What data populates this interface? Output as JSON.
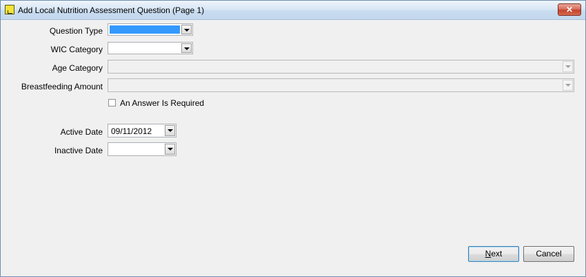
{
  "window": {
    "title": "Add Local Nutrition Assessment Question (Page 1)",
    "close_label": "✕"
  },
  "form": {
    "question_type": {
      "label": "Question Type",
      "value": ""
    },
    "wic_category": {
      "label": "WIC Category",
      "value": ""
    },
    "age_category": {
      "label": "Age Category",
      "value": ""
    },
    "breastfeeding_amount": {
      "label": "Breastfeeding Amount",
      "value": ""
    },
    "answer_required": {
      "label": "An Answer Is Required",
      "checked": false
    },
    "active_date": {
      "label": "Active Date",
      "value": "09/11/2012"
    },
    "inactive_date": {
      "label": "Inactive Date",
      "value": ""
    }
  },
  "buttons": {
    "next_mnemonic": "N",
    "next_rest": "ext",
    "cancel_label": "Cancel"
  },
  "colors": {
    "selection": "#3399ff",
    "titlebar": "#c9dcf0",
    "close": "#c2432c"
  }
}
